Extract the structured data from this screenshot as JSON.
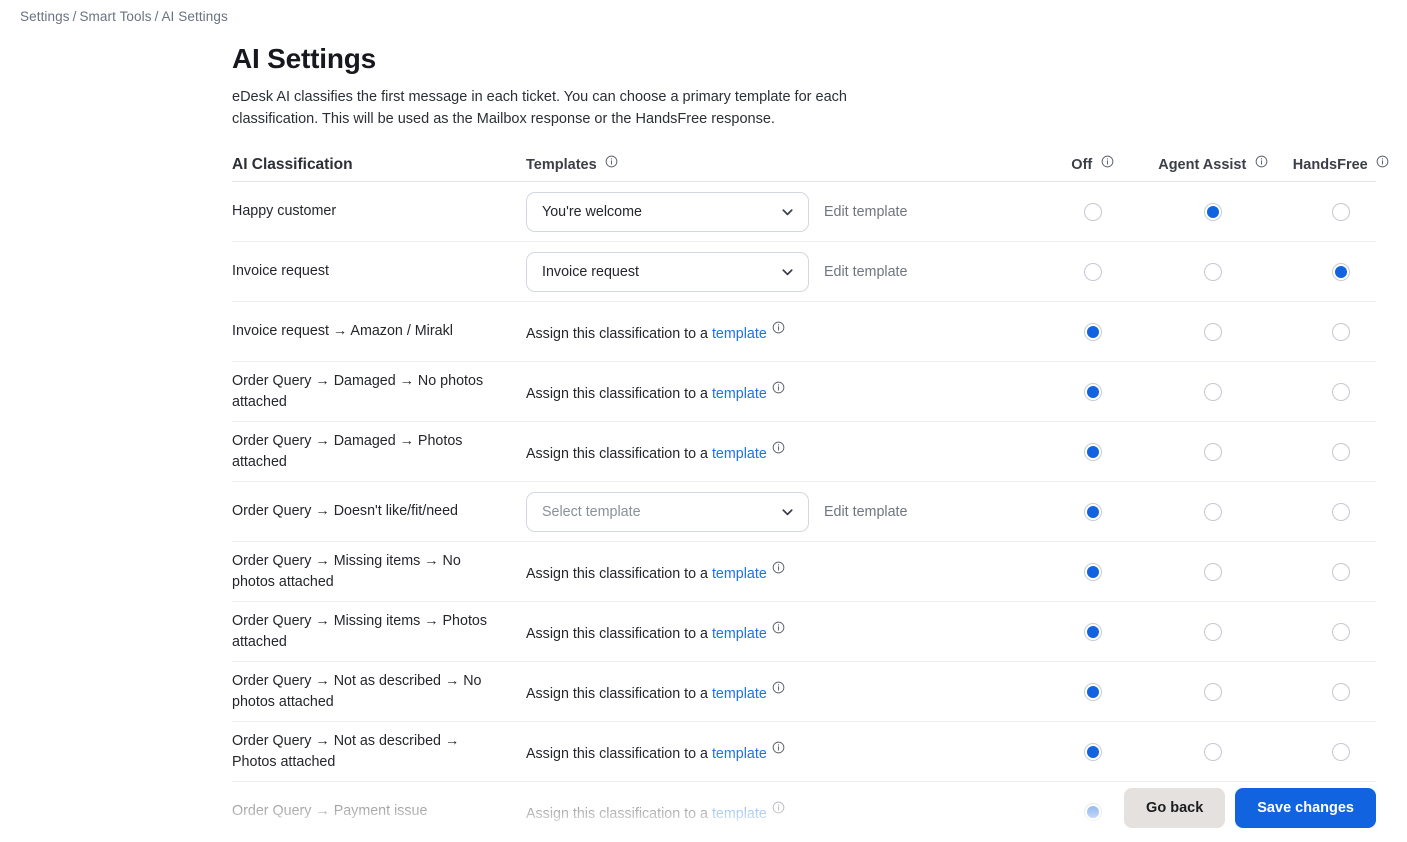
{
  "breadcrumb": {
    "items": [
      "Settings",
      "Smart Tools",
      "AI Settings"
    ],
    "separator": "/"
  },
  "header": {
    "title": "AI Settings",
    "description": "eDesk AI classifies the first message in each ticket. You can choose a primary template for each classification. This will be used as the Mailbox response or the HandsFree response."
  },
  "table": {
    "headers": {
      "classification": "AI Classification",
      "templates": "Templates",
      "off": "Off",
      "agent_assist": "Agent Assist",
      "handsfree": "HandsFree"
    },
    "edit_template_label": "Edit template",
    "assign_prefix": "Assign this classification to a ",
    "assign_link": "template",
    "select_placeholder": "Select template",
    "rows": [
      {
        "classification": "Happy customer",
        "template_kind": "select",
        "template_value": "You're welcome",
        "is_placeholder": false,
        "mode": "agent_assist",
        "faded": false
      },
      {
        "classification": "Invoice request",
        "template_kind": "select",
        "template_value": "Invoice request",
        "is_placeholder": false,
        "mode": "handsfree",
        "faded": false
      },
      {
        "classification": "Invoice request → Amazon / Mirakl",
        "template_kind": "assign",
        "template_value": "",
        "is_placeholder": false,
        "mode": "off",
        "faded": false
      },
      {
        "classification": "Order Query → Damaged → No photos attached",
        "template_kind": "assign",
        "template_value": "",
        "is_placeholder": false,
        "mode": "off",
        "faded": false
      },
      {
        "classification": "Order Query → Damaged → Photos attached",
        "template_kind": "assign",
        "template_value": "",
        "is_placeholder": false,
        "mode": "off",
        "faded": false
      },
      {
        "classification": "Order Query → Doesn't like/fit/need",
        "template_kind": "select",
        "template_value": "Select template",
        "is_placeholder": true,
        "mode": "off",
        "faded": false
      },
      {
        "classification": "Order Query → Missing items → No photos attached",
        "template_kind": "assign",
        "template_value": "",
        "is_placeholder": false,
        "mode": "off",
        "faded": false
      },
      {
        "classification": "Order Query → Missing items → Photos attached",
        "template_kind": "assign",
        "template_value": "",
        "is_placeholder": false,
        "mode": "off",
        "faded": false
      },
      {
        "classification": "Order Query → Not as described → No photos attached",
        "template_kind": "assign",
        "template_value": "",
        "is_placeholder": false,
        "mode": "off",
        "faded": false
      },
      {
        "classification": "Order Query → Not as described → Photos attached",
        "template_kind": "assign",
        "template_value": "",
        "is_placeholder": false,
        "mode": "off",
        "faded": false
      },
      {
        "classification": "Order Query → Payment issue",
        "template_kind": "assign",
        "template_value": "",
        "is_placeholder": false,
        "mode": "off",
        "faded": true
      }
    ]
  },
  "footer": {
    "go_back_label": "Go back",
    "save_label": "Save changes"
  },
  "icons": {
    "info": "info-icon",
    "chevron": "chevron-down-icon"
  },
  "colors": {
    "accent_blue": "#1263e0",
    "link_blue": "#1a73e8",
    "secondary_button": "#e4e1de",
    "border": "#e3e5ea",
    "text": "#24262c",
    "muted_text": "#70757e"
  }
}
